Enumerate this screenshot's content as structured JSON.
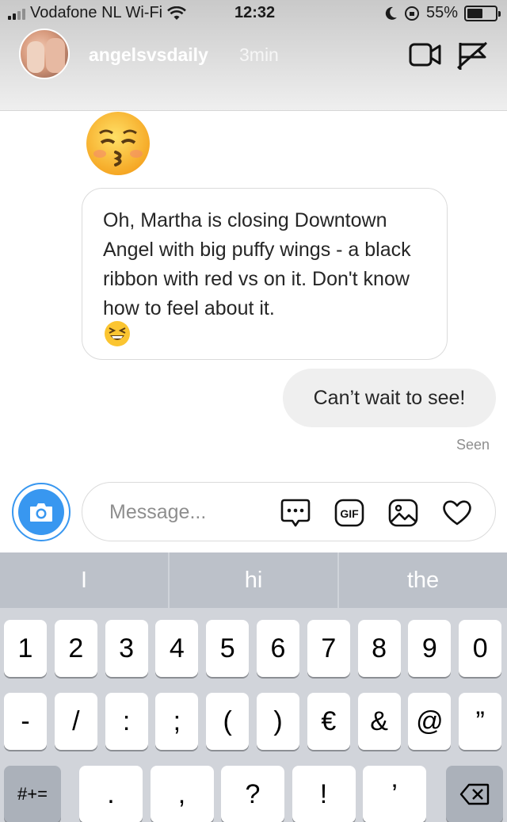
{
  "status_bar": {
    "carrier": "Vodafone NL Wi-Fi",
    "time": "12:32",
    "battery": "55%",
    "battery_level": 0.55
  },
  "header": {
    "username": "angelsvsdaily",
    "time_ago": "3min",
    "icons": [
      "video-call-icon",
      "flag-icon"
    ]
  },
  "messages": {
    "incoming_emoji": "kissing-face-emoji",
    "incoming_text": "Oh, Martha is closing Downtown Angel with big puffy wings - a black ribbon with red vs on it. Don't know how to feel about it.",
    "incoming_text_emoji": "laughing-face-emoji",
    "outgoing_text": "Can’t wait to see!",
    "seen_label": "Seen"
  },
  "composer": {
    "placeholder": "Message...",
    "icons": [
      "camera-icon",
      "chat-bubble-icon",
      "gif-icon",
      "gallery-icon",
      "heart-icon"
    ],
    "gif_label": "GIF"
  },
  "keyboard": {
    "suggestions": [
      "I",
      "hi",
      "the"
    ],
    "row1": [
      "1",
      "2",
      "3",
      "4",
      "5",
      "6",
      "7",
      "8",
      "9",
      "0"
    ],
    "row2": [
      "-",
      "/",
      ":",
      ";",
      "(",
      ")",
      "€",
      "&",
      "@",
      "”"
    ],
    "mode_key": "#+=",
    "row3": [
      ".",
      ",",
      "?",
      "!",
      "’"
    ],
    "delete_icon": "backspace-icon"
  },
  "colors": {
    "accent": "#3897f0",
    "bubble_out": "#efefef",
    "keyboard_bg": "#d1d4da"
  }
}
